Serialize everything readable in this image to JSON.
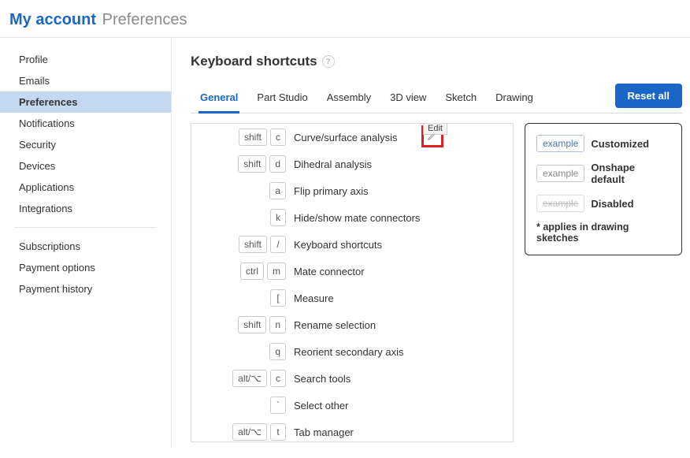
{
  "header": {
    "title_main": "My account",
    "title_sub": "Preferences"
  },
  "sidebar": {
    "group1": [
      "Profile",
      "Emails",
      "Preferences",
      "Notifications",
      "Security",
      "Devices",
      "Applications",
      "Integrations"
    ],
    "group2": [
      "Subscriptions",
      "Payment options",
      "Payment history"
    ],
    "active": "Preferences"
  },
  "page": {
    "title": "Keyboard shortcuts"
  },
  "tabs": {
    "items": [
      "General",
      "Part Studio",
      "Assembly",
      "3D view",
      "Sketch",
      "Drawing"
    ],
    "active": "General"
  },
  "reset_label": "Reset all",
  "tooltip": "Edit",
  "shortcuts": [
    {
      "keys": [
        "shift",
        "c"
      ],
      "label": "Curve/surface analysis",
      "editable": true
    },
    {
      "keys": [
        "shift",
        "d"
      ],
      "label": "Dihedral analysis"
    },
    {
      "keys": [
        "a"
      ],
      "label": "Flip primary axis"
    },
    {
      "keys": [
        "k"
      ],
      "label": "Hide/show mate connectors"
    },
    {
      "keys": [
        "shift",
        "/"
      ],
      "label": "Keyboard shortcuts"
    },
    {
      "keys": [
        "ctrl",
        "m"
      ],
      "label": "Mate connector"
    },
    {
      "keys": [
        "["
      ],
      "label": "Measure"
    },
    {
      "keys": [
        "shift",
        "n"
      ],
      "label": "Rename selection"
    },
    {
      "keys": [
        "q"
      ],
      "label": "Reorient secondary axis"
    },
    {
      "keys": [
        "alt/⌥",
        "c"
      ],
      "label": "Search tools"
    },
    {
      "keys": [
        "`"
      ],
      "label": "Select other"
    },
    {
      "keys": [
        "alt/⌥",
        "t"
      ],
      "label": "Tab manager"
    }
  ],
  "legend": {
    "chip_text": "example",
    "labels": {
      "customized": "Customized",
      "default": "Onshape default",
      "disabled": "Disabled"
    },
    "note": "* applies in drawing sketches"
  }
}
